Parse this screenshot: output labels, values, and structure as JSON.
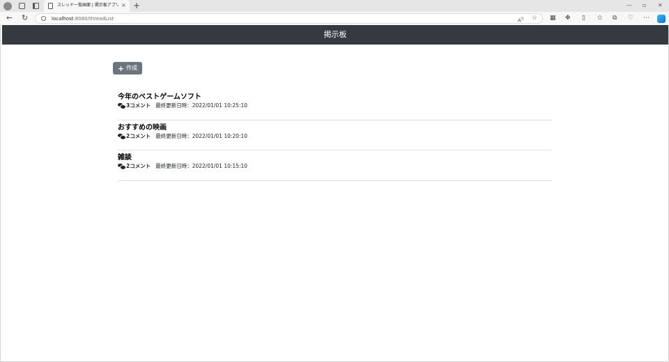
{
  "browser": {
    "tab_title": "スレッド一覧画面 | 掲示板アプリ",
    "tab_close": "×",
    "new_tab": "+",
    "url_host": "localhost",
    "url_path": ":8080/threadList",
    "window_controls": {
      "minimize": "—",
      "maximize": "▫",
      "close": "✕"
    },
    "icons": [
      "profile-icon",
      "workspaces-icon",
      "tab-actions-icon",
      "back-icon",
      "refresh-icon",
      "read-aloud-icon",
      "favorite-icon",
      "extensions-icon",
      "split-screen-icon",
      "favorites-icon",
      "collections-icon",
      "browser-essentials-icon",
      "more-icon",
      "copilot-icon"
    ]
  },
  "navbar": {
    "title": "掲示板"
  },
  "actions": {
    "create_label": "作成",
    "create_icon": "plus-icon"
  },
  "threads": [
    {
      "title": "今年のベストゲームソフト",
      "comments": "3コメント",
      "updated": "最終更新日時：2022/01/01 10:25:10"
    },
    {
      "title": "おすすめの映画",
      "comments": "2コメント",
      "updated": "最終更新日時：2022/01/01 10:20:10"
    },
    {
      "title": "雑談",
      "comments": "2コメント",
      "updated": "最終更新日時：2022/01/01 10:15:10"
    }
  ],
  "colors": {
    "navbar_bg": "#343a40",
    "button_bg": "#6c757d",
    "divider": "#dee2e6"
  }
}
